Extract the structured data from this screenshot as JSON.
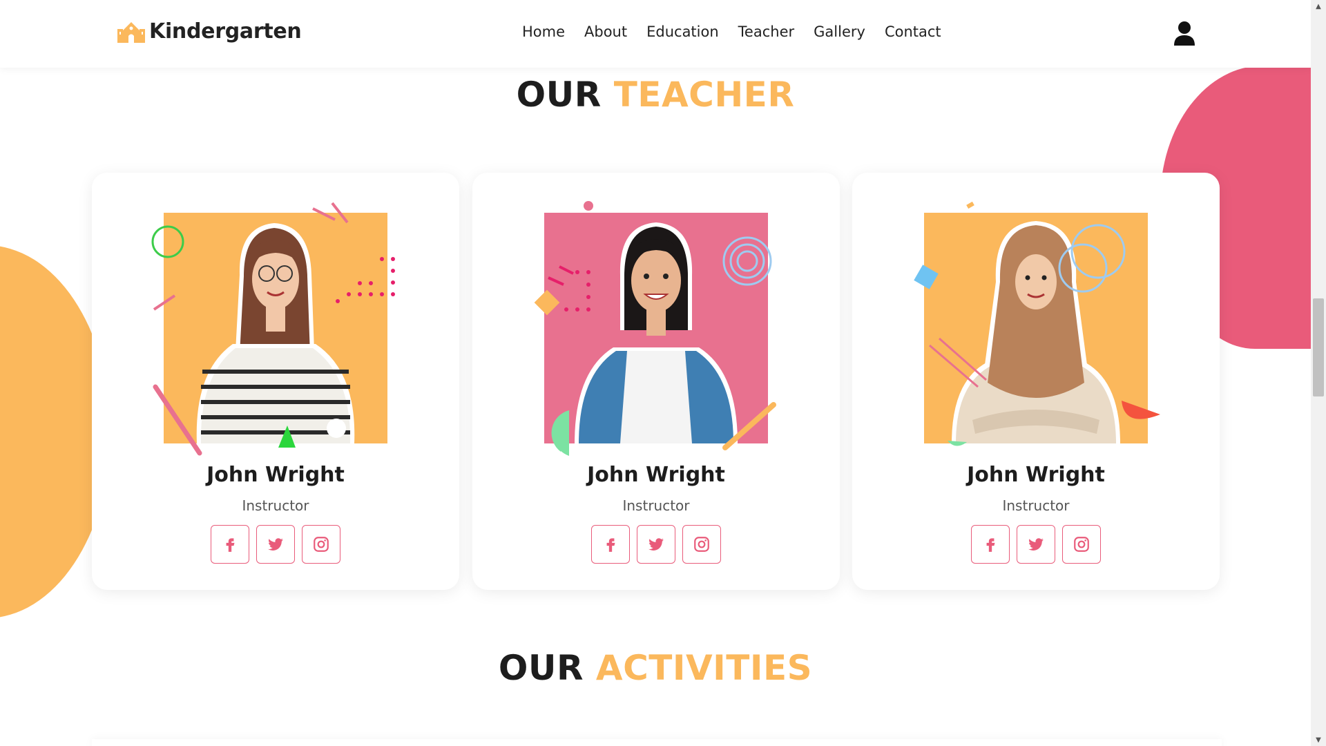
{
  "brand": {
    "name": "Kindergarten"
  },
  "nav": {
    "items": [
      {
        "label": "Home"
      },
      {
        "label": "About"
      },
      {
        "label": "Education"
      },
      {
        "label": "Teacher"
      },
      {
        "label": "Gallery"
      },
      {
        "label": "Contact"
      }
    ]
  },
  "sections": {
    "teacher": {
      "title_dark": "OUR",
      "title_accent": "TEACHER"
    },
    "activities": {
      "title_dark": "OUR",
      "title_accent": "ACTIVITIES"
    }
  },
  "teachers": [
    {
      "name": "John Wright",
      "role": "Instructor",
      "photo_color": "#fbb85c"
    },
    {
      "name": "John Wright",
      "role": "Instructor",
      "photo_color": "#e8718f"
    },
    {
      "name": "John Wright",
      "role": "Instructor",
      "photo_color": "#fbb85c"
    }
  ],
  "social_icons": [
    "facebook-icon",
    "twitter-icon",
    "instagram-icon"
  ],
  "colors": {
    "accent_orange": "#fbb85c",
    "accent_pink": "#e95b7a",
    "text_dark": "#1d1d1d"
  }
}
